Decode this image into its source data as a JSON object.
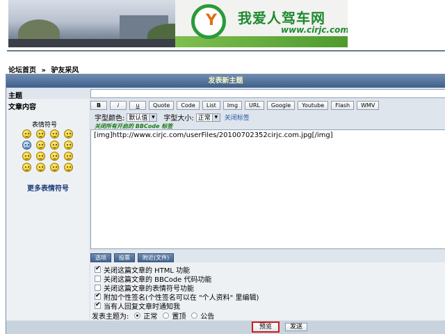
{
  "banner": {
    "logo_text": "我爱人驾车网",
    "logo_url": "www.cirjc.com"
  },
  "breadcrumb": {
    "home": "论坛首页",
    "separator": "»",
    "forum": "驴友采风"
  },
  "form": {
    "header": "发表新主题",
    "subject_label": "主题",
    "content_label": "文章内容",
    "toolbar": [
      "B",
      "i",
      "u",
      "Quote",
      "Code",
      "List",
      "Img",
      "URL",
      "Google",
      "Youtube",
      "Flash",
      "WMV"
    ],
    "font_color_label": "字型颜色:",
    "font_color_value": "默认值",
    "font_size_label": "字型大小:",
    "font_size_value": "正常",
    "close_tags": "关闭标签",
    "notice": "关闭所有开启的 BBCode 标签",
    "content_value": "[img]http://www.cirjc.com/userFiles/20100702352cirjc.com.jpg[/img]"
  },
  "emoticons": {
    "title": "表情符号",
    "more": "更多表情符号",
    "count": 16
  },
  "tabs": [
    "选项",
    "投票",
    "附近(文件)"
  ],
  "options": [
    {
      "label": "关闭这篇文章的 HTML 功能",
      "checked": true
    },
    {
      "label": "关闭这篇文章的 BBCode 代码功能",
      "checked": false
    },
    {
      "label": "关闭这篇文章的表情符号功能",
      "checked": false
    },
    {
      "label": "附加个性签名(个性签名可以在 \"个人资料\" 里编辑)",
      "checked": true
    },
    {
      "label": "当有人回复文章时通知我",
      "checked": true
    }
  ],
  "topic_type": {
    "label": "发表主题为:",
    "choices": [
      {
        "label": "正常",
        "selected": true
      },
      {
        "label": "置顶",
        "selected": false
      },
      {
        "label": "公告",
        "selected": false
      }
    ]
  },
  "buttons": {
    "preview": "预览",
    "send": "发送"
  },
  "colors": {
    "header_gradient_top": "#6f8bb0",
    "header_gradient_bottom": "#3f5f8a",
    "logo_green": "#1e8a2e",
    "highlight_red": "#d01818"
  }
}
